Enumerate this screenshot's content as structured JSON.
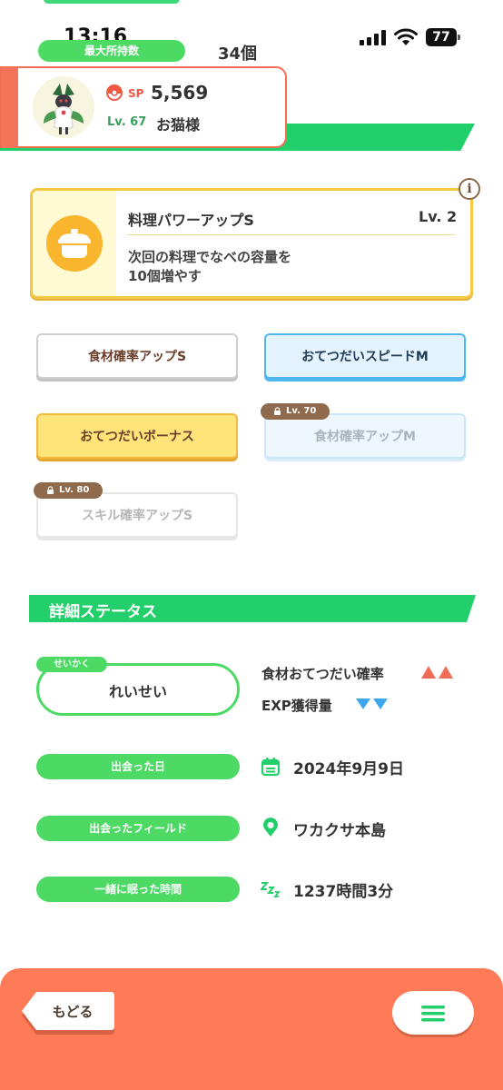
{
  "status_bar": {
    "time": "13:16",
    "battery": "77"
  },
  "storage": {
    "max_label": "最大所持数",
    "max_value": "34個"
  },
  "pokemon": {
    "sp_label": "SP",
    "sp_value": "5,569",
    "level": "Lv. 67",
    "name": "お猫様"
  },
  "main_skill": {
    "name": "料理パワーアップS",
    "level": "Lv. 2",
    "description_line1": "次回の料理でなべの容量を",
    "description_line2": "10個増やす",
    "info_label": "i"
  },
  "sub_skills": [
    {
      "label": "食材確率アップS",
      "locked": false
    },
    {
      "label": "おてつだいスピードM",
      "locked": false
    },
    {
      "label": "おてつだいボーナス",
      "locked": false
    },
    {
      "label": "食材確率アップM",
      "locked": true,
      "unlock_level": "Lv. 70"
    },
    {
      "label": "スキル確率アップS",
      "locked": true,
      "unlock_level": "Lv. 80"
    }
  ],
  "details": {
    "header": "詳細ステータス",
    "nature_tag": "せいかく",
    "nature_value": "れいせい",
    "nature_up": "食材おてつだい確率",
    "nature_down": "EXP獲得量",
    "met_date_label": "出会った日",
    "met_date_value": "2024年9月9日",
    "met_field_label": "出会ったフィールド",
    "met_field_value": "ワカクサ本島",
    "sleep_time_label": "一緒に眠った時間",
    "sleep_time_value": "1237時間3分"
  },
  "bottom_nav": {
    "back_label": "もどる",
    "menu_icon": "hamburger-icon"
  },
  "colors": {
    "green": "#22cf6a",
    "light_green": "#4cd964",
    "coral": "#ff7a56",
    "gold": "#f5c842",
    "blue": "#50b6f1",
    "up_arrow": "#f06e55",
    "down_arrow": "#3ea6ef"
  }
}
